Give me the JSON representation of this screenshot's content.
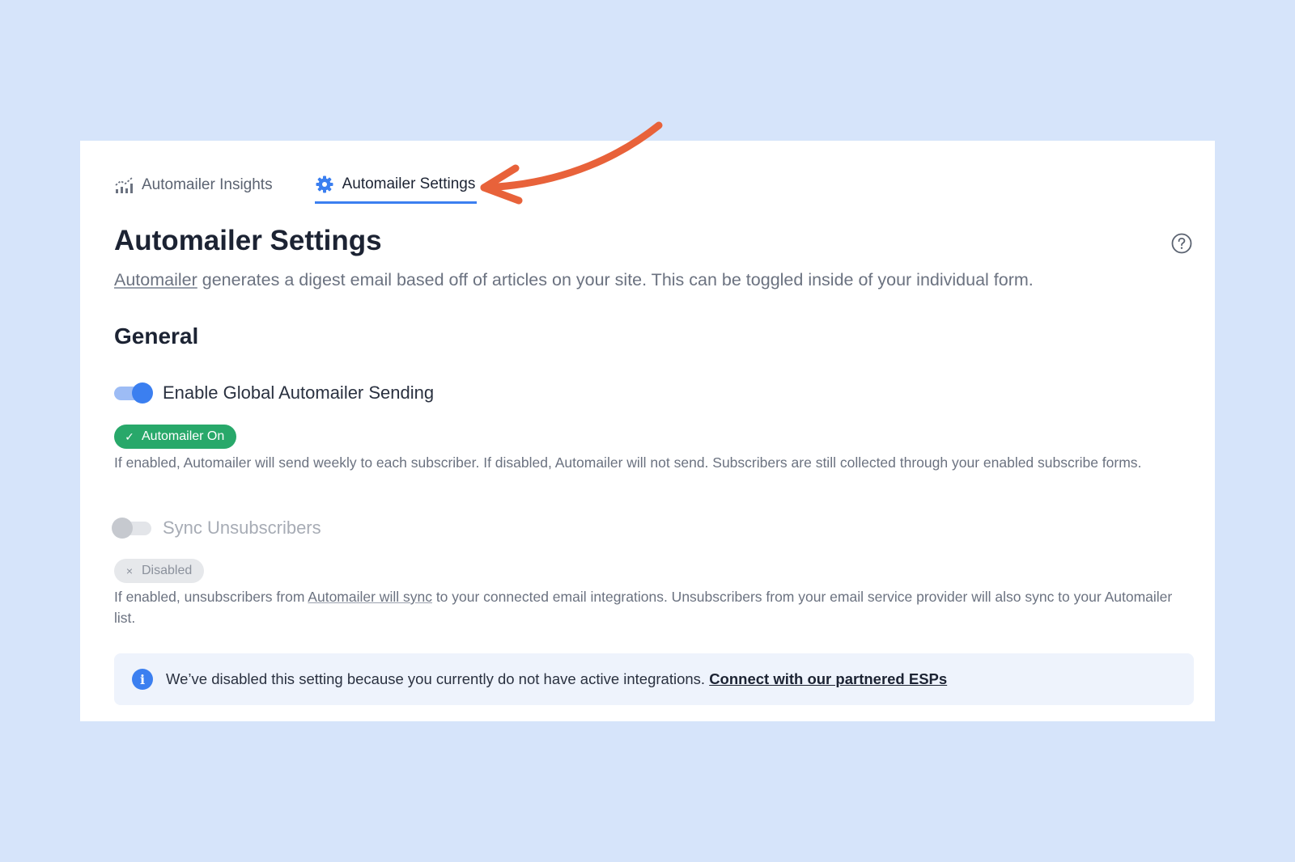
{
  "tabs": [
    {
      "label": "Automailer Insights",
      "icon": "bar-chart-icon",
      "active": false
    },
    {
      "label": "Automailer Settings",
      "icon": "gear-icon",
      "active": true
    }
  ],
  "header": {
    "title": "Automailer Settings",
    "description_link": "Automailer",
    "description_rest": " generates a digest email based off of articles on your site. This can be toggled inside of your individual form.",
    "help_icon": "question-circle-icon"
  },
  "general": {
    "title": "General",
    "global_sending": {
      "label": "Enable Global Automailer Sending",
      "enabled": true,
      "badge": "Automailer On",
      "badge_icon": "check-icon",
      "hint": "If enabled, Automailer will send weekly to each subscriber. If disabled, Automailer will not send. Subscribers are still collected through your enabled subscribe forms."
    },
    "sync_unsubscribers": {
      "label": "Sync Unsubscribers",
      "enabled": false,
      "disabled": true,
      "badge": "Disabled",
      "badge_icon": "x-icon",
      "hint_before": "If enabled, unsubscribers from ",
      "hint_link": "Automailer will sync",
      "hint_after": " to your connected email integrations. Unsubscribers from your email service provider will also sync to your Automailer list."
    }
  },
  "info_banner": {
    "icon": "info-icon",
    "text": "We’ve disabled this setting because you currently do not have active integrations. ",
    "link": "Connect with our partnered ESPs"
  },
  "colors": {
    "background": "#d6e4fa",
    "accent": "#3b7ff0",
    "success": "#28a86a",
    "annotation_arrow": "#e8623a"
  }
}
